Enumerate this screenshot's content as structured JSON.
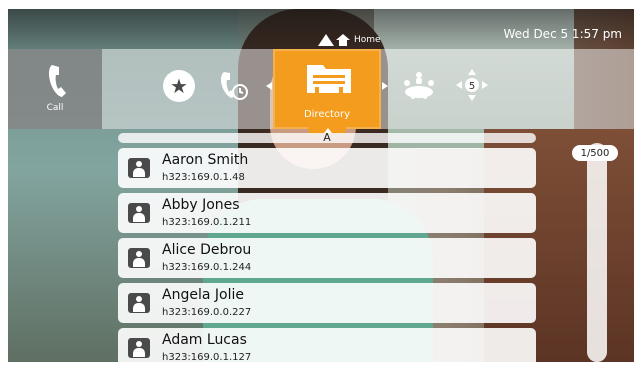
{
  "status": {
    "datetime": "Wed Dec 5  1:57 pm"
  },
  "home": {
    "label": "Home"
  },
  "nav": {
    "call_label": "Call",
    "directory_label": "Directory",
    "icons": [
      "favorites-star-icon",
      "recent-calls-icon",
      "directory-folder-icon",
      "conference-icon",
      "dpad-5-icon"
    ],
    "dpad_center": "5"
  },
  "directory": {
    "current_letter": "A",
    "position": "1/500",
    "entries": [
      {
        "name": "Aaron Smith",
        "address": "h323:169.0.1.48"
      },
      {
        "name": "Abby Jones",
        "address": "h323:169.0.1.211"
      },
      {
        "name": "Alice Debrou",
        "address": "h323:169.0.1.244"
      },
      {
        "name": "Angela Jolie",
        "address": "h323:169.0.0.227"
      },
      {
        "name": "Adam Lucas",
        "address": "h323:169.0.1.127"
      }
    ]
  },
  "colors": {
    "accent": "#f39c1e",
    "text": "#111111"
  }
}
